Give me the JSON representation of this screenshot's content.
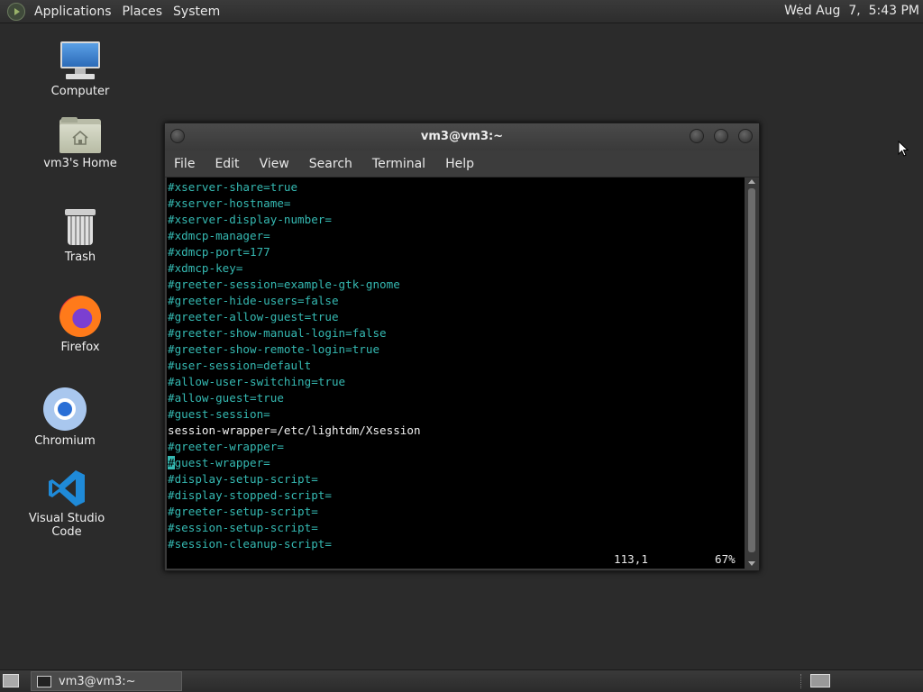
{
  "top_panel": {
    "menus": [
      "Applications",
      "Places",
      "System"
    ],
    "clock": "Wed Aug  7,  5:43 PM"
  },
  "desktop": {
    "icons": [
      {
        "label": "Computer",
        "icon": "computer-icon"
      },
      {
        "label": "vm3's Home",
        "icon": "home-folder-icon"
      },
      {
        "label": "Trash",
        "icon": "trash-icon"
      },
      {
        "label": "Firefox",
        "icon": "firefox-icon"
      },
      {
        "label": "Chromium",
        "icon": "chromium-icon"
      },
      {
        "label": "Visual Studio Code",
        "icon": "vscode-icon"
      }
    ]
  },
  "terminal": {
    "title": "vm3@vm3:~",
    "menu": [
      "File",
      "Edit",
      "View",
      "Search",
      "Terminal",
      "Help"
    ],
    "lines": [
      "#xserver-share=true",
      "#xserver-hostname=",
      "#xserver-display-number=",
      "#xdmcp-manager=",
      "#xdmcp-port=177",
      "#xdmcp-key=",
      "#greeter-session=example-gtk-gnome",
      "#greeter-hide-users=false",
      "#greeter-allow-guest=true",
      "#greeter-show-manual-login=false",
      "#greeter-show-remote-login=true",
      "#user-session=default",
      "#allow-user-switching=true",
      "#allow-guest=true",
      "#guest-session=",
      "session-wrapper=/etc/lightdm/Xsession",
      "#greeter-wrapper=",
      "#guest-wrapper=",
      "#display-setup-script=",
      "#display-stopped-script=",
      "#greeter-setup-script=",
      "#session-setup-script=",
      "#session-cleanup-script="
    ],
    "cursor_line_index": 17,
    "status_position": "113,1",
    "status_percent": "67%",
    "colors": {
      "comment": "#35b9b2",
      "plain": "#f2f2f2",
      "background": "#000000"
    }
  },
  "taskbar": {
    "task_label": "vm3@vm3:~"
  }
}
